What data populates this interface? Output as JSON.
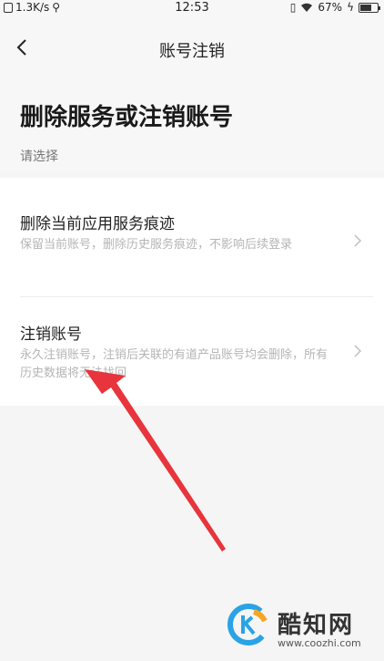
{
  "status_bar": {
    "speed": "1.3K/s",
    "time": "12:53",
    "battery_percent": "67%",
    "battery_level": 0.67
  },
  "nav": {
    "back_icon": "chevron-left-icon",
    "title": "账号注销"
  },
  "header": {
    "heading": "删除服务或注销账号",
    "subtitle": "请选择"
  },
  "options": [
    {
      "title": "删除当前应用服务痕迹",
      "description": "保留当前账号，删除历史服务痕迹，不影响后续登录",
      "icon": "chevron-right-icon"
    },
    {
      "title": "注销账号",
      "description": "永久注销账号，注销后关联的有道产品账号均会删除，所有历史数据将无法找回",
      "icon": "chevron-right-icon"
    }
  ],
  "annotation": {
    "color": "#e8343c"
  },
  "watermark": {
    "brand": "酷知网",
    "url": "www.coozhi.com",
    "colors": {
      "blue": "#2aa3e6",
      "orange": "#f5a623"
    }
  }
}
